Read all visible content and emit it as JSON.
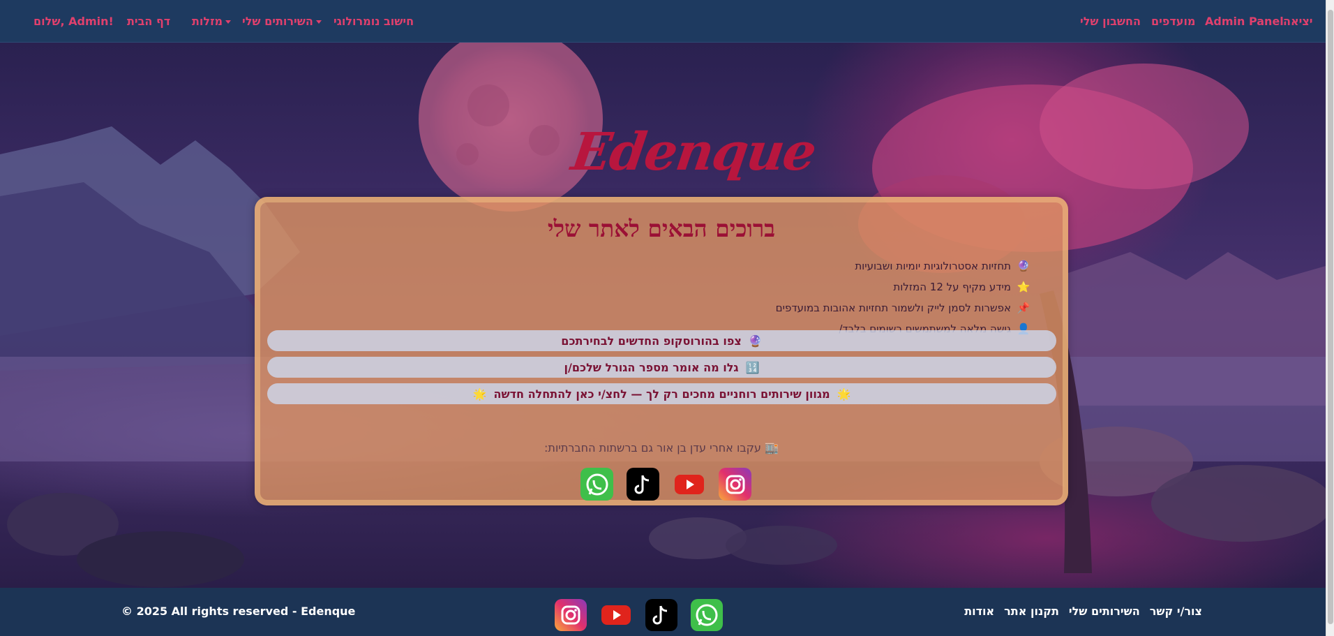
{
  "colors": {
    "nav_bg": "#1e3a60",
    "nav_link": "#e0406d",
    "card_bg": "#e2965f",
    "title": "#9b1035",
    "footer_bg": "#1c3455"
  },
  "navbar": {
    "left_links": {
      "logout": "יציאה",
      "admin_panel": "Admin Panel",
      "favorites": "מועדפים",
      "my_account": "החשבון שלי"
    },
    "right_links": {
      "numerology": "חישוב נומרולוגי",
      "my_services": "השירותים שלי",
      "zodiac": "מזלות",
      "home": "דף הבית",
      "greeting": "שלום, Admin!"
    }
  },
  "hero": {
    "logo": "Edenque",
    "title": "ברוכים הבאים לאתר שלי",
    "features": [
      {
        "icon": "crystal-ball-icon",
        "text": "תחזיות אסטרולוגיות יומיות ושבועיות"
      },
      {
        "icon": "star-icon",
        "text": "מידע מקיף על 12 המזלות"
      },
      {
        "icon": "pin-icon",
        "text": "אפשרות לסמן לייק ולשמור תחזיות אהובות במועדפים"
      },
      {
        "icon": "user-icon",
        "text": "גישה מלאה למשתמשים רשומים בלבד/"
      }
    ],
    "buttons": [
      {
        "icon": "crystal-ball-icon",
        "text": "צפו בהורוסקופ החדשים לבחירתכם"
      },
      {
        "icon": "numbers-icon",
        "text": "גלו מה אומר מספר הגורל שלכם/ן"
      },
      {
        "icon": "sparkle-icon",
        "text": "מגוון שירותים רוחניים מחכים רק לך — לחצ/י כאן להתחלה חדשה"
      }
    ],
    "follow_text": "עקבו אחרי עדן בן אור גם ברשתות החברתיות:",
    "social": [
      "whatsapp-icon",
      "tiktok-icon",
      "youtube-icon",
      "instagram-icon"
    ]
  },
  "footer": {
    "copyright": "© 2025 All rights reserved - Edenque",
    "links": [
      "צור/י קשר",
      "השירותים שלי",
      "תקנון אתר",
      "אודות"
    ],
    "social": [
      "instagram-icon",
      "youtube-icon",
      "tiktok-icon",
      "whatsapp-icon"
    ]
  }
}
